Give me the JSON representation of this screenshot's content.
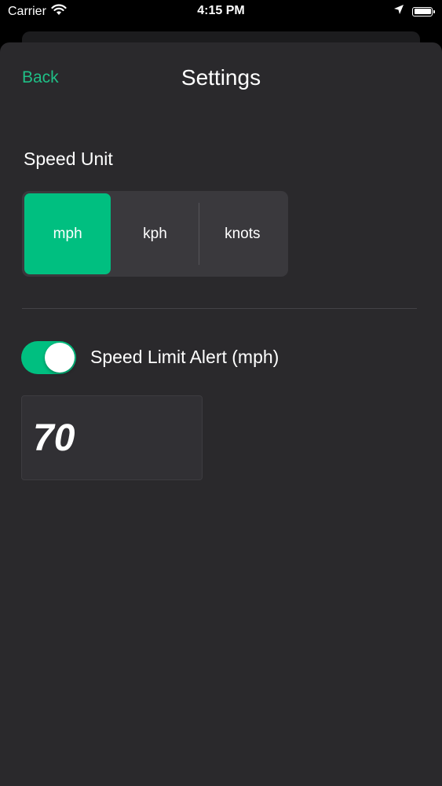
{
  "status_bar": {
    "carrier": "Carrier",
    "time": "4:15 PM",
    "icons": [
      "wifi-icon",
      "location-arrow-icon",
      "battery-icon"
    ]
  },
  "nav": {
    "back_label": "Back",
    "title": "Settings"
  },
  "speed_unit": {
    "label": "Speed Unit",
    "options": [
      "mph",
      "kph",
      "knots"
    ],
    "selected": "mph"
  },
  "speed_limit_alert": {
    "enabled": true,
    "label": "Speed Limit Alert (mph)",
    "value": "70"
  },
  "colors": {
    "accent": "#00bf80",
    "back_link": "#1fbf86",
    "sheet_background": "#2a292c",
    "segment_background": "#3a393d"
  }
}
